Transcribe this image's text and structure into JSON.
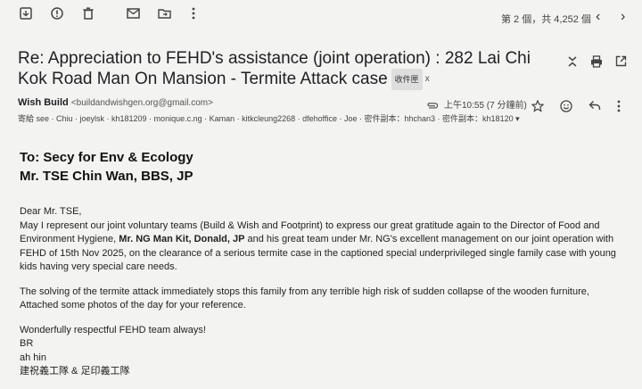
{
  "toolbar": {
    "icons": [
      "archive-icon",
      "report-spam-icon",
      "delete-icon",
      "mark-unread-icon",
      "move-to-icon",
      "more-icon"
    ],
    "pager_text": "第 2 個，共 4,252 個"
  },
  "email": {
    "subject": "Re: Appreciation to FEHD's assistance (joint operation) : 282 Lai Chi Kok Road Man On Mansion - Termite Attack case",
    "label_tag": "收件匣",
    "label_remove": "x",
    "sender_name": "Wish Build",
    "sender_email": "<buildandwishgen.org@gmail.com>",
    "recipients": "寄給 see · Chiu · joeylsk · kh181209 · monique.c.ng · Kaman · kitkcleung2268 · dfehoffice · Joe · 密件副本：hhchan3 · 密件副本：kh18120 ▾",
    "time": "上午10:55 (7 分鐘前)"
  },
  "letter": {
    "to_line": "To: Secy for Env & Ecology",
    "addressee": "Mr. TSE Chin Wan, BBS, JP",
    "salutation": "Dear Mr. TSE,",
    "para1_a": "May I represent our joint voluntary teams (Build & Wish and Footprint) to express our great gratitude again to the Director of Food and Environment Hygiene, ",
    "para1_bold": "Mr. NG Man Kit, Donald, JP",
    "para1_b": " and his great team under Mr. NG's excellent management on our joint operation with FEHD of 15th Nov 2025, on the clearance of a serious termite case in the captioned special underprivileged single family case with young kids having very special care needs.",
    "para2_line1": "The solving of the termite attack immediately stops this family from any terrible high risk of sudden collapse of the wooden furniture,",
    "para2_line2": "Attached some photos of the day for your reference.",
    "closing": "Wonderfully respectful FEHD team always!",
    "br": "BR",
    "name": "ah hin",
    "signature": "建祝義工隊 & 足印義工隊"
  }
}
